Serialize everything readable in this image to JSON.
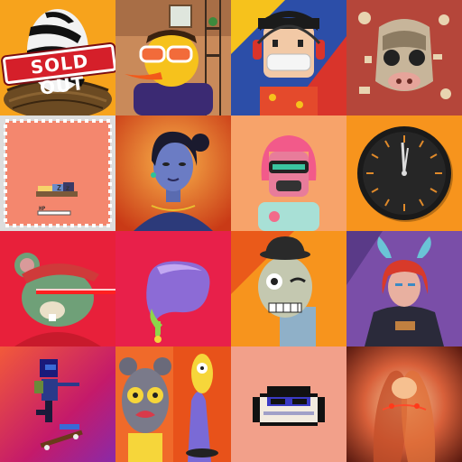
{
  "gallery": {
    "tiles": [
      {
        "id": "t1",
        "badge": "SOLD OUT"
      },
      {
        "id": "t2"
      },
      {
        "id": "t3"
      },
      {
        "id": "t4"
      },
      {
        "id": "t5",
        "hp_label": "HP",
        "sleep_label": "Z z"
      },
      {
        "id": "t6"
      },
      {
        "id": "t7"
      },
      {
        "id": "t8"
      },
      {
        "id": "t9"
      },
      {
        "id": "t10"
      },
      {
        "id": "t11"
      },
      {
        "id": "t12"
      },
      {
        "id": "t13"
      },
      {
        "id": "t14"
      },
      {
        "id": "t15"
      },
      {
        "id": "t16"
      }
    ]
  },
  "colors": {
    "sold_out_red": "#d51f2a",
    "orange_bg": "#f7941d",
    "salmon_bg": "#f4876e",
    "red_bg": "#e8203a"
  }
}
